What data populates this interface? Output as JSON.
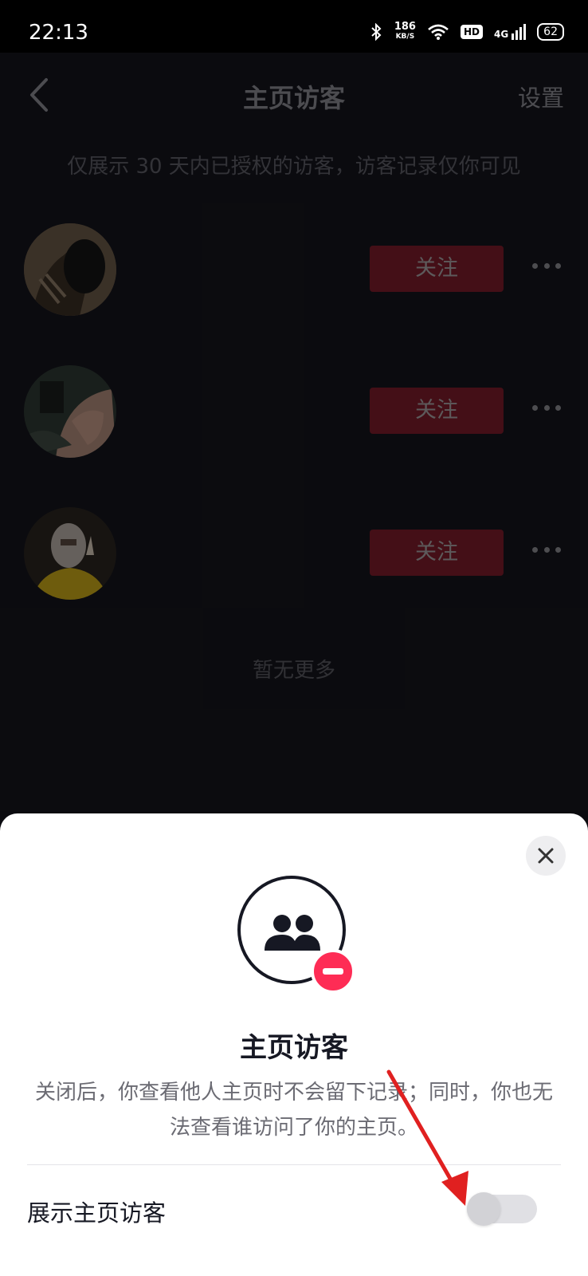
{
  "status_bar": {
    "time": "22:13",
    "net_speed_value": "186",
    "net_speed_unit": "KB/S",
    "hd": "HD",
    "network": "4G",
    "battery": "62"
  },
  "header": {
    "title": "主页访客",
    "settings": "设置"
  },
  "notice": "仅展示 30 天内已授权的访客，访客记录仅你可见",
  "visitors": [
    {
      "name": "",
      "follow_label": "关注"
    },
    {
      "name": "",
      "follow_label": "关注"
    },
    {
      "name": "",
      "follow_label": "关注"
    }
  ],
  "no_more": "暂无更多",
  "sheet": {
    "title": "主页访客",
    "description": "关闭后，你查看他人主页时不会留下记录；同时，你也无法查看谁访问了你的主页。",
    "toggle_label": "展示主页访客",
    "toggle_on": false
  },
  "colors": {
    "follow_button": "#7c1d2b",
    "badge_red": "#fe2c55",
    "arrow": "#e02020"
  }
}
